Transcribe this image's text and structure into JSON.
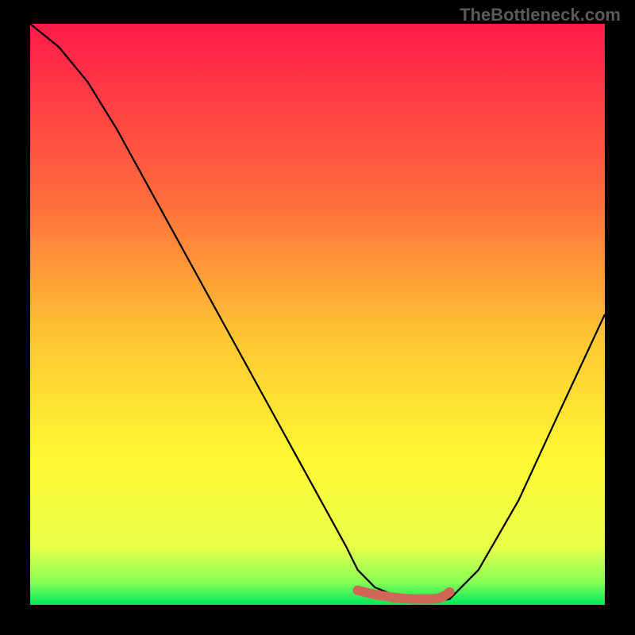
{
  "attribution": "TheBottleneck.com",
  "chart_data": {
    "type": "line",
    "title": "",
    "xlabel": "",
    "ylabel": "",
    "xlim": [
      0,
      100
    ],
    "ylim": [
      0,
      100
    ],
    "gradient_stops": [
      {
        "offset": 0,
        "color": "#ff1a4a"
      },
      {
        "offset": 30,
        "color": "#ff6b3d"
      },
      {
        "offset": 55,
        "color": "#ffc933"
      },
      {
        "offset": 75,
        "color": "#fff833"
      },
      {
        "offset": 90,
        "color": "#e8ff4a"
      },
      {
        "offset": 96,
        "color": "#8aff55"
      },
      {
        "offset": 100,
        "color": "#00e85a"
      }
    ],
    "series": [
      {
        "name": "bottleneck-curve",
        "color": "#000000",
        "x": [
          0,
          5,
          10,
          15,
          20,
          25,
          30,
          35,
          40,
          45,
          50,
          55,
          57,
          60,
          65,
          68,
          70,
          73,
          78,
          85,
          92,
          100
        ],
        "y": [
          100,
          96,
          90,
          82,
          73,
          64,
          55,
          46,
          37,
          28,
          19,
          10,
          6,
          3,
          1,
          0.5,
          0.5,
          1,
          6,
          18,
          33,
          50
        ]
      },
      {
        "name": "optimal-marker",
        "color": "#d0665a",
        "type": "marker",
        "x": [
          57,
          59,
          61,
          63,
          65,
          67,
          69,
          71,
          72,
          73
        ],
        "y": [
          2.5,
          2,
          1.6,
          1.3,
          1.1,
          1.0,
          1.0,
          1.1,
          1.5,
          2.2
        ]
      }
    ]
  }
}
